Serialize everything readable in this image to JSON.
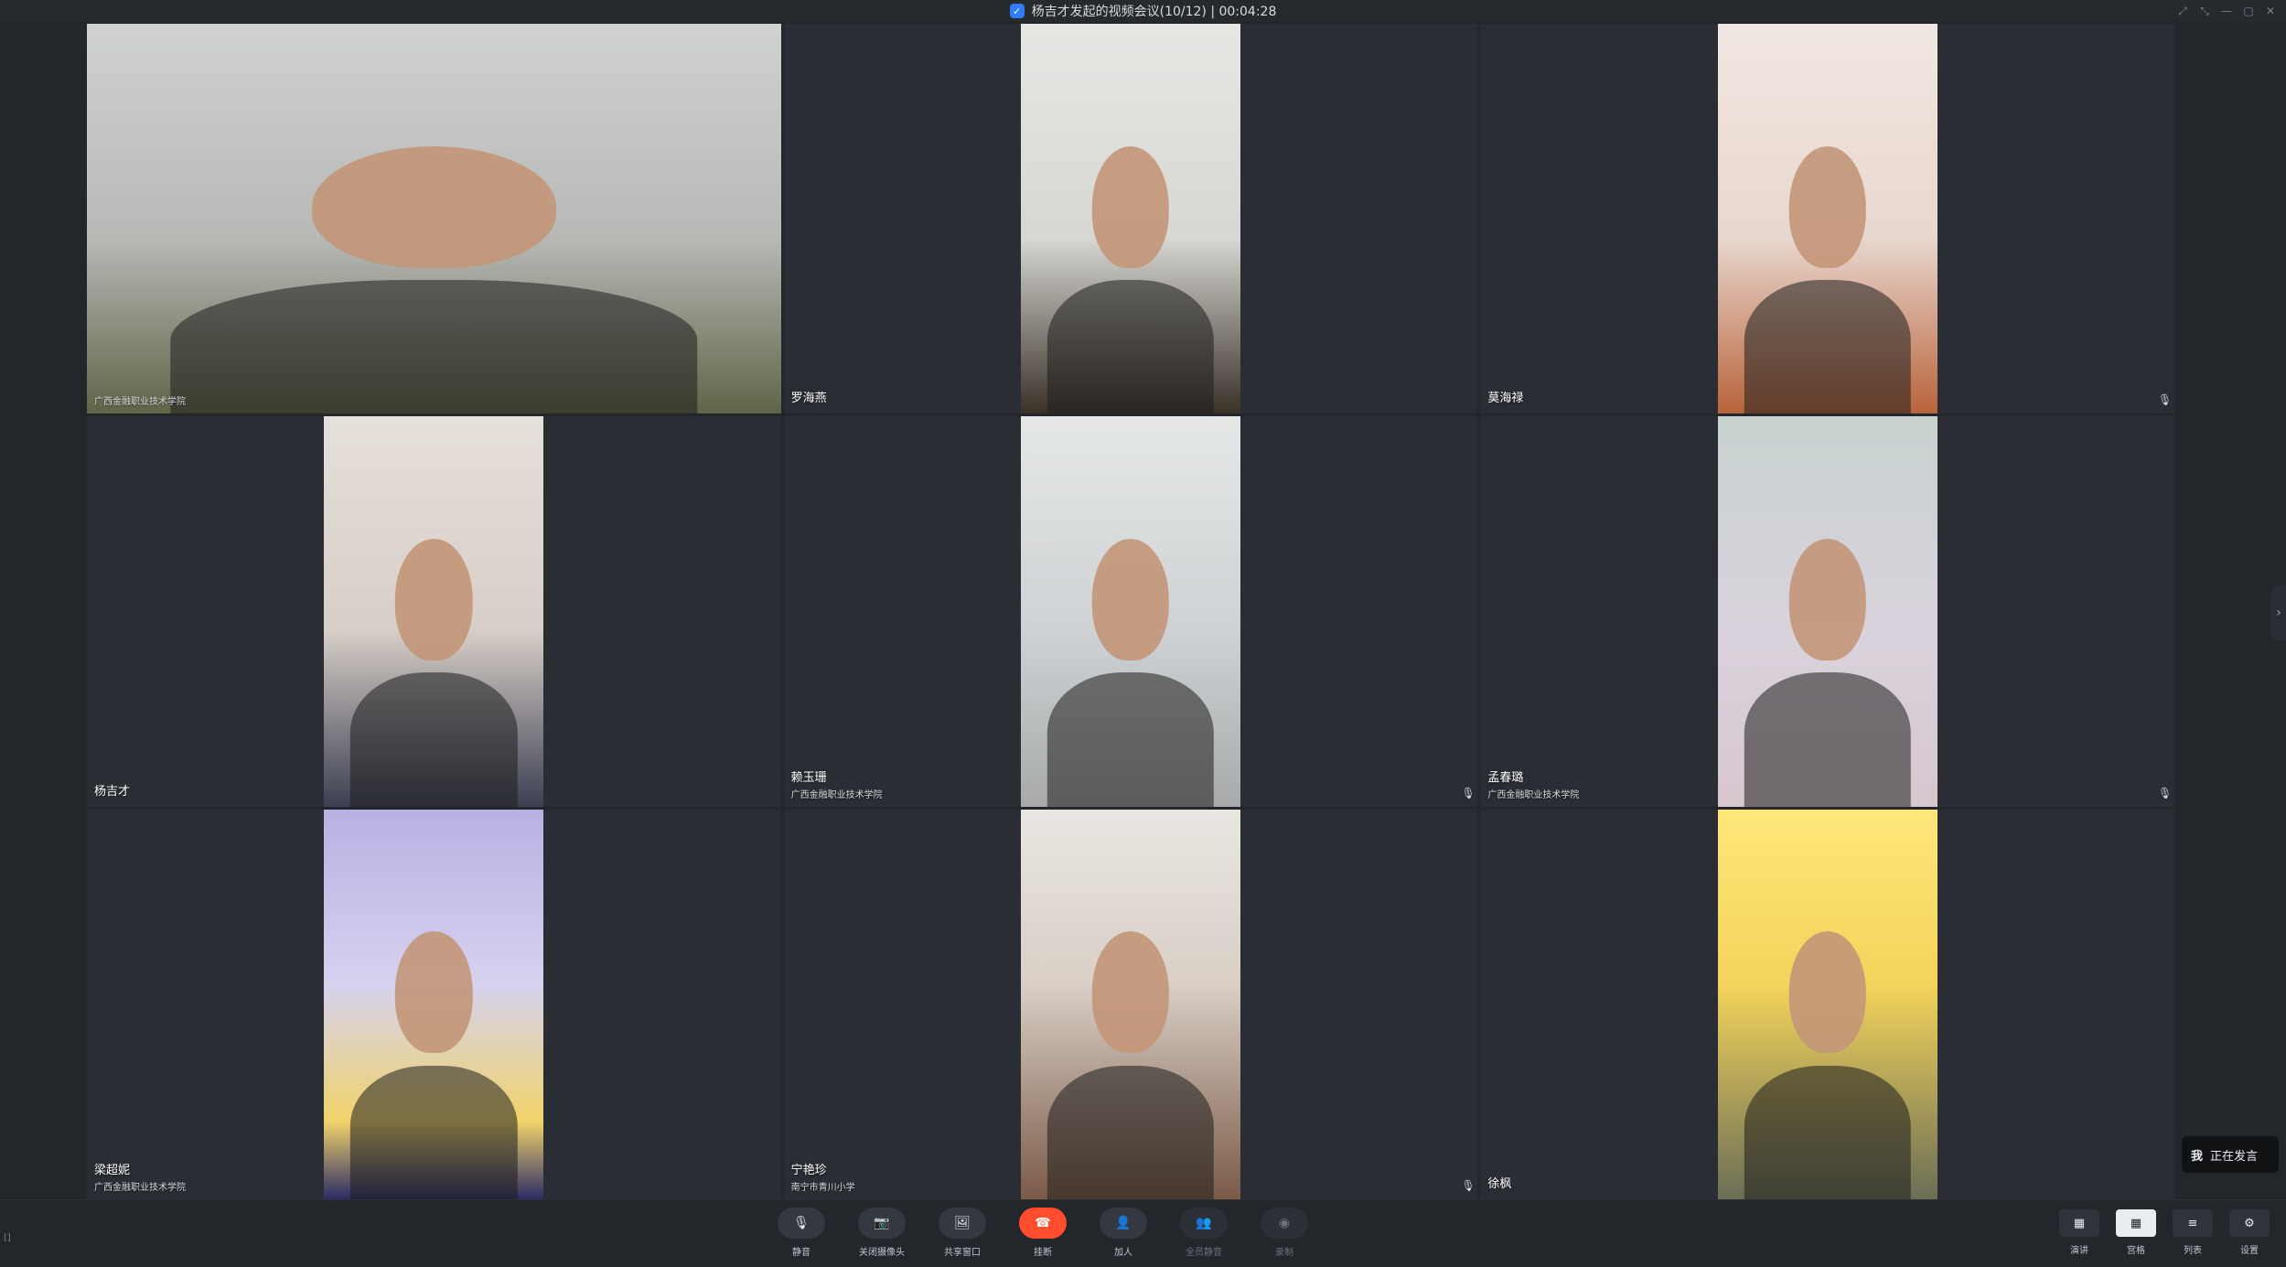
{
  "window": {
    "title": "杨吉才发起的视频会议(10/12) | 00:04:28"
  },
  "tiles": [
    {
      "name": "",
      "org": "广西金融职业技术学院",
      "mic": "",
      "active": true,
      "wide": true
    },
    {
      "name": "罗海燕",
      "org": "",
      "mic": ""
    },
    {
      "name": "莫海禄",
      "org": "",
      "mic": "🎙"
    },
    {
      "name": "杨吉才",
      "org": "",
      "mic": ""
    },
    {
      "name": "赖玉珊",
      "org": "广西金融职业技术学院",
      "mic": "🎙"
    },
    {
      "name": "孟春璐",
      "org": "广西金融职业技术学院",
      "mic": "🎙"
    },
    {
      "name": "梁超妮",
      "org": "广西金融职业技术学院",
      "mic": ""
    },
    {
      "name": "宁艳珍",
      "org": "南宁市青川小学",
      "mic": "🎙"
    },
    {
      "name": "徐枫",
      "org": "",
      "mic": ""
    }
  ],
  "speaking": {
    "me": "我",
    "text": "正在发言"
  },
  "toolbar": {
    "actions": [
      {
        "label": "静音",
        "icon": "mic-icon",
        "glyph": "🎙",
        "state": "normal"
      },
      {
        "label": "关闭摄像头",
        "icon": "camera-icon",
        "glyph": "📷",
        "state": "normal"
      },
      {
        "label": "共享窗口",
        "icon": "share-window-icon",
        "glyph": "🖼",
        "state": "normal"
      },
      {
        "label": "挂断",
        "icon": "hangup-icon",
        "glyph": "☎",
        "state": "hangup"
      },
      {
        "label": "加人",
        "icon": "add-user-icon",
        "glyph": "👤",
        "state": "normal"
      },
      {
        "label": "全员静音",
        "icon": "mute-all-icon",
        "glyph": "👥",
        "state": "disabled"
      },
      {
        "label": "录制",
        "icon": "record-icon",
        "glyph": "◉",
        "state": "disabled"
      }
    ],
    "views": [
      {
        "label": "演讲",
        "icon": "speaker-view-icon",
        "glyph": "▦",
        "selected": false
      },
      {
        "label": "宫格",
        "icon": "grid-view-icon",
        "glyph": "▦",
        "selected": true
      },
      {
        "label": "列表",
        "icon": "list-view-icon",
        "glyph": "≡",
        "selected": false
      },
      {
        "label": "设置",
        "icon": "settings-icon",
        "glyph": "⚙",
        "selected": false
      }
    ]
  },
  "misc": {
    "left_marker": "[]",
    "edge_arrow": "›"
  }
}
